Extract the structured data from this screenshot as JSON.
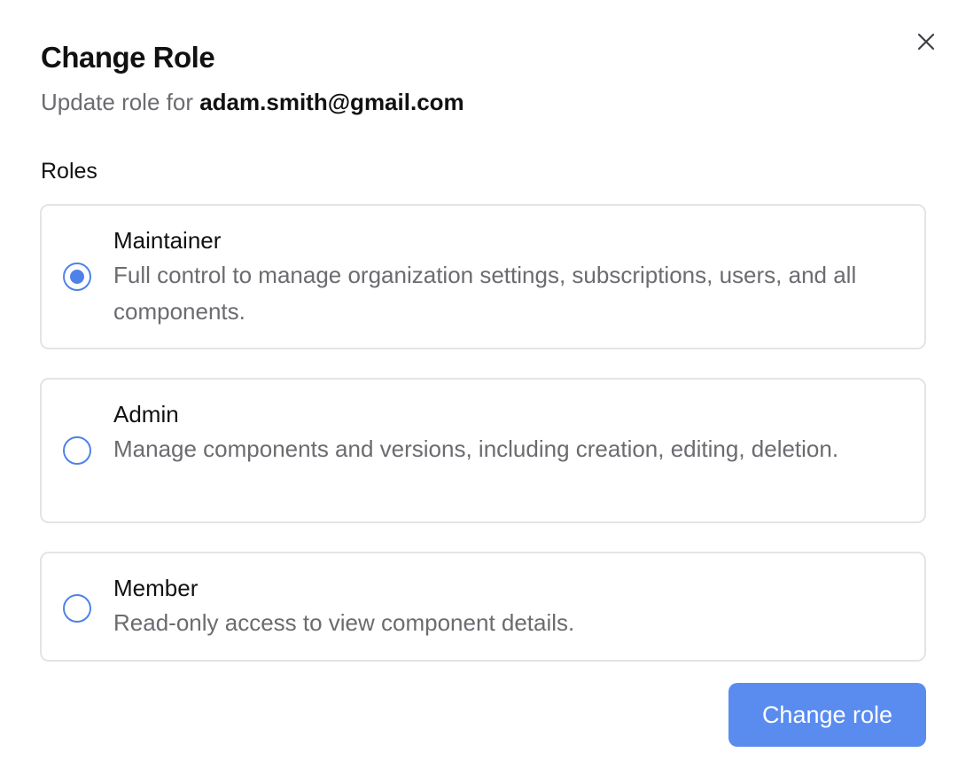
{
  "dialog": {
    "title": "Change Role",
    "subtitle_prefix": "Update role for",
    "email": "adam.smith@gmail.com",
    "close_icon": "close-icon"
  },
  "roles_section": {
    "label": "Roles",
    "selected": "maintainer",
    "options": [
      {
        "id": "maintainer",
        "name": "Maintainer",
        "description": "Full control to manage organization settings, subscriptions, users, and all components.",
        "selected": true
      },
      {
        "id": "admin",
        "name": "Admin",
        "description": "Manage components and versions, including creation, editing, deletion.",
        "selected": false
      },
      {
        "id": "member",
        "name": "Member",
        "description": "Read-only access to view component details.",
        "selected": false
      }
    ]
  },
  "actions": {
    "submit_label": "Change role"
  },
  "colors": {
    "accent": "#5a8cf0",
    "radio_border": "#4f82e8",
    "muted_text": "#6b6b70",
    "card_border": "#e4e4e7"
  }
}
